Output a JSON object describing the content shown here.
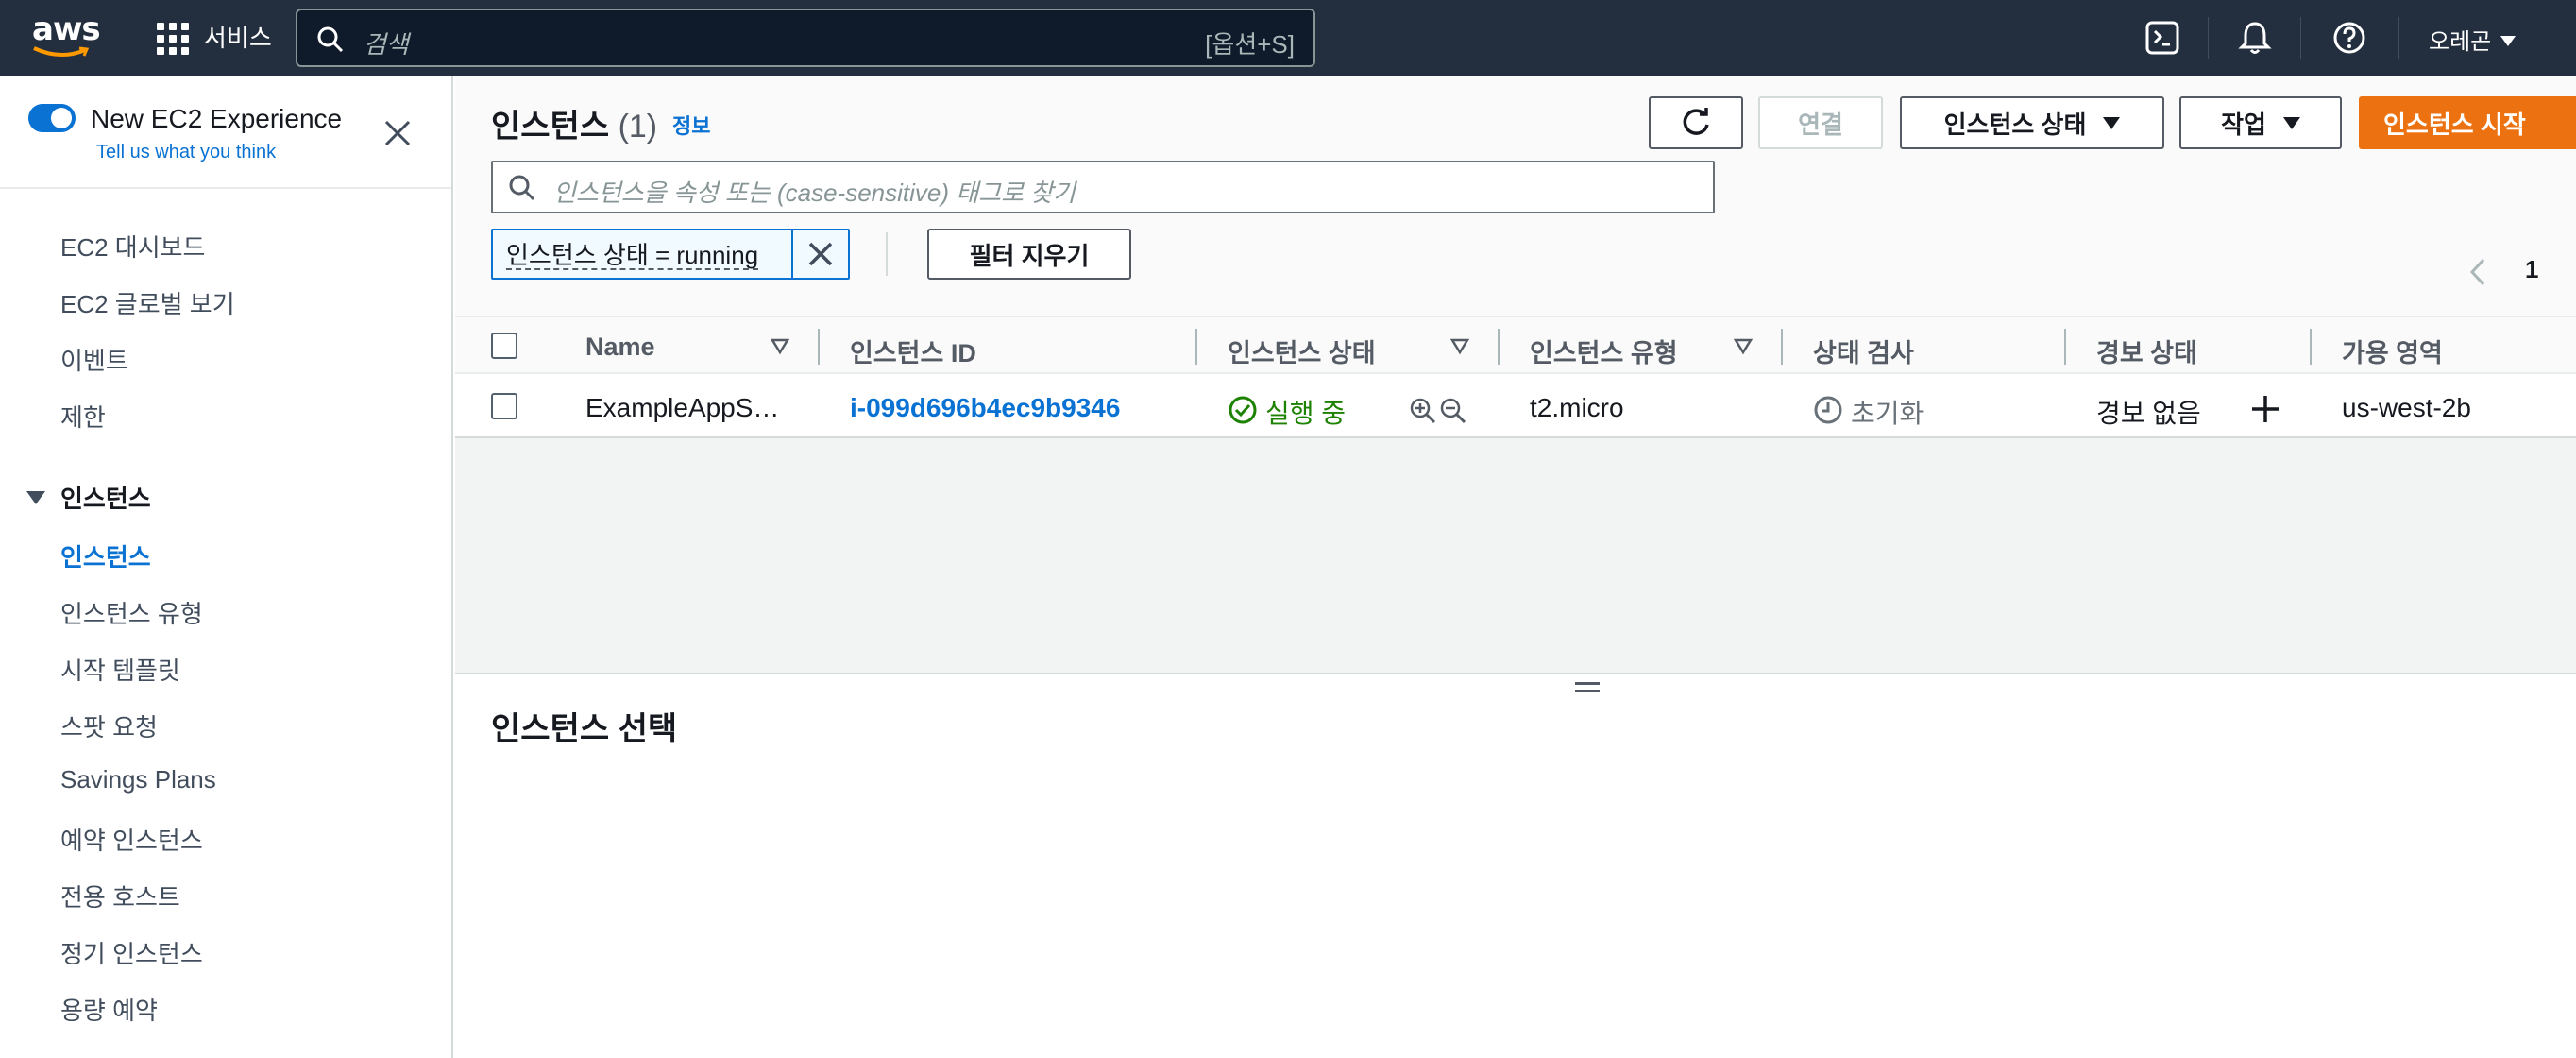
{
  "topbar": {
    "logo_text": "aws",
    "services_label": "서비스",
    "search_placeholder": "검색",
    "search_shortcut": "[옵션+S]",
    "region_label": "오레곤"
  },
  "sidebar": {
    "experience_title": "New EC2 Experience",
    "experience_link": "Tell us what you think",
    "items_top": [
      "EC2 대시보드",
      "EC2 글로벌 보기",
      "이벤트",
      "제한"
    ],
    "section_label": "인스턴스",
    "items_instances": [
      "인스턴스",
      "인스턴스 유형",
      "시작 템플릿",
      "스팟 요청",
      "Savings Plans",
      "예약 인스턴스",
      "전용 호스트",
      "정기 인스턴스",
      "용량 예약"
    ]
  },
  "header": {
    "title": "인스턴스",
    "count": "(1)",
    "info_link": "정보",
    "connect_label": "연결",
    "instance_state_label": "인스턴스 상태",
    "actions_label": "작업",
    "launch_label": "인스턴스 시작",
    "filter_placeholder": "인스턴스을 속성 또는 (case-sensitive) 태그로 찾기",
    "filter_token": "인스턴스 상태 = running",
    "clear_filters_label": "필터 지우기",
    "page_number": "1"
  },
  "table": {
    "columns": [
      "Name",
      "인스턴스 ID",
      "인스턴스 상태",
      "인스턴스 유형",
      "상태 검사",
      "경보 상태",
      "가용 영역"
    ],
    "rows": [
      {
        "name": "ExampleAppS…",
        "instance_id": "i-099d696b4ec9b9346",
        "state": "실행 중",
        "type": "t2.micro",
        "status_check": "초기화",
        "alarm": "경보 없음",
        "az": "us-west-2b"
      }
    ]
  },
  "detail": {
    "title": "인스턴스 선택"
  },
  "colors": {
    "topbar_bg": "#232f3e",
    "accent_blue": "#0972d3",
    "primary_orange": "#ec7211",
    "running_green": "#1d8102"
  }
}
